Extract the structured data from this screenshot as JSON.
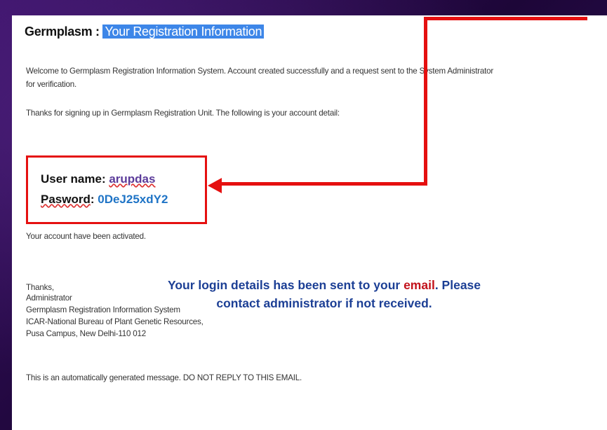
{
  "heading": {
    "prefix": "Germplasm : ",
    "highlight": "Your Registration Information"
  },
  "body": {
    "welcome_line1": "Welcome to Germplasm Registration Information System. Account created successfully and a request sent to the System Administrator",
    "welcome_line2": "for verification.",
    "thanks_signup": "Thanks for signing up in Germplasm Registration Unit. The following is your account detail:",
    "activated": "Your account have been activated."
  },
  "credentials": {
    "user_label": "User name",
    "user_value": "arupdas",
    "pass_label": "Pasword",
    "pass_value": "0DeJ25xdY2",
    "separator": ": "
  },
  "notice": {
    "part1": "Your login details has been sent to your ",
    "email_word": "email",
    "part2": ". Please",
    "line2": "contact administrator if not received."
  },
  "signature": {
    "thanks": "Thanks,",
    "from": "Administrator",
    "org": "Germplasm Registration Information System",
    "bureau": "ICAR-National Bureau of Plant Genetic Resources,",
    "address": "Pusa Campus, New Delhi-110 012"
  },
  "footer": {
    "auto_message": "This is an automatically generated message. DO NOT REPLY TO THIS EMAIL."
  },
  "colors": {
    "callout_red": "#e51010",
    "highlight_blue": "#3d86e8",
    "notice_blue": "#1c3f95",
    "email_red": "#c2121b",
    "background_purple": "#2a0b4a"
  }
}
